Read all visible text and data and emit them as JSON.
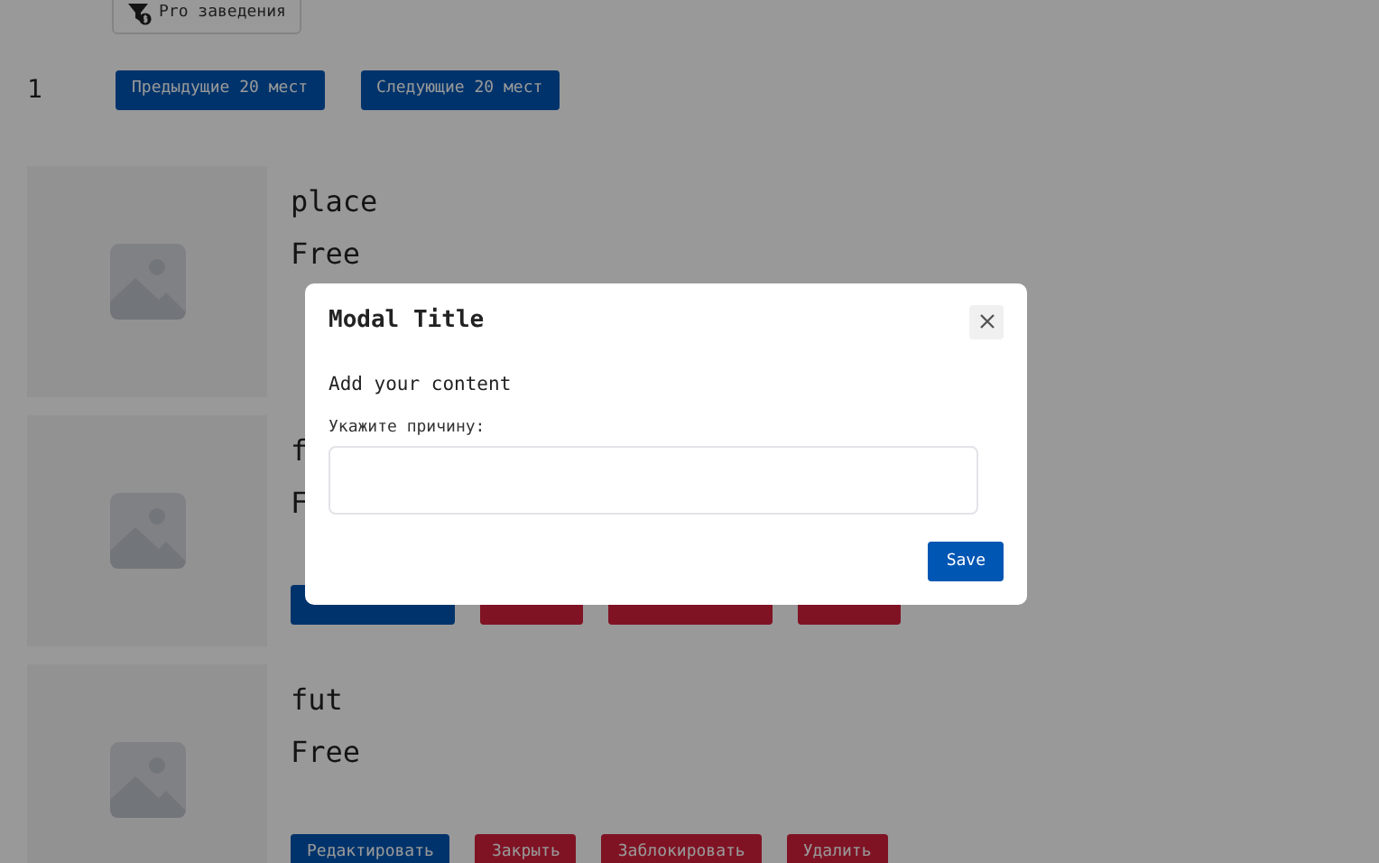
{
  "filter_button": {
    "label": "Pro заведения"
  },
  "pagination": {
    "page": "1",
    "previous": "Предыдущие 20 мест",
    "next": "Следующие 20 мест"
  },
  "places": [
    {
      "name": "place",
      "price": "Free"
    },
    {
      "name": "f",
      "price": "F",
      "buttons": [
        {
          "kind": "edit"
        },
        {
          "kind": "danger"
        },
        {
          "kind": "danger"
        },
        {
          "kind": "danger"
        }
      ]
    },
    {
      "name": "fut",
      "price": "Free",
      "buttons": [
        {
          "kind": "edit",
          "label": "Редактировать"
        },
        {
          "kind": "danger",
          "label": "Закрыть"
        },
        {
          "kind": "danger",
          "label": "Заблокировать"
        },
        {
          "kind": "danger",
          "label": "Удалить"
        }
      ]
    }
  ],
  "modal": {
    "title": "Modal Title",
    "body": "Add your content",
    "field_label": "Укажите причину:",
    "save": "Save"
  }
}
